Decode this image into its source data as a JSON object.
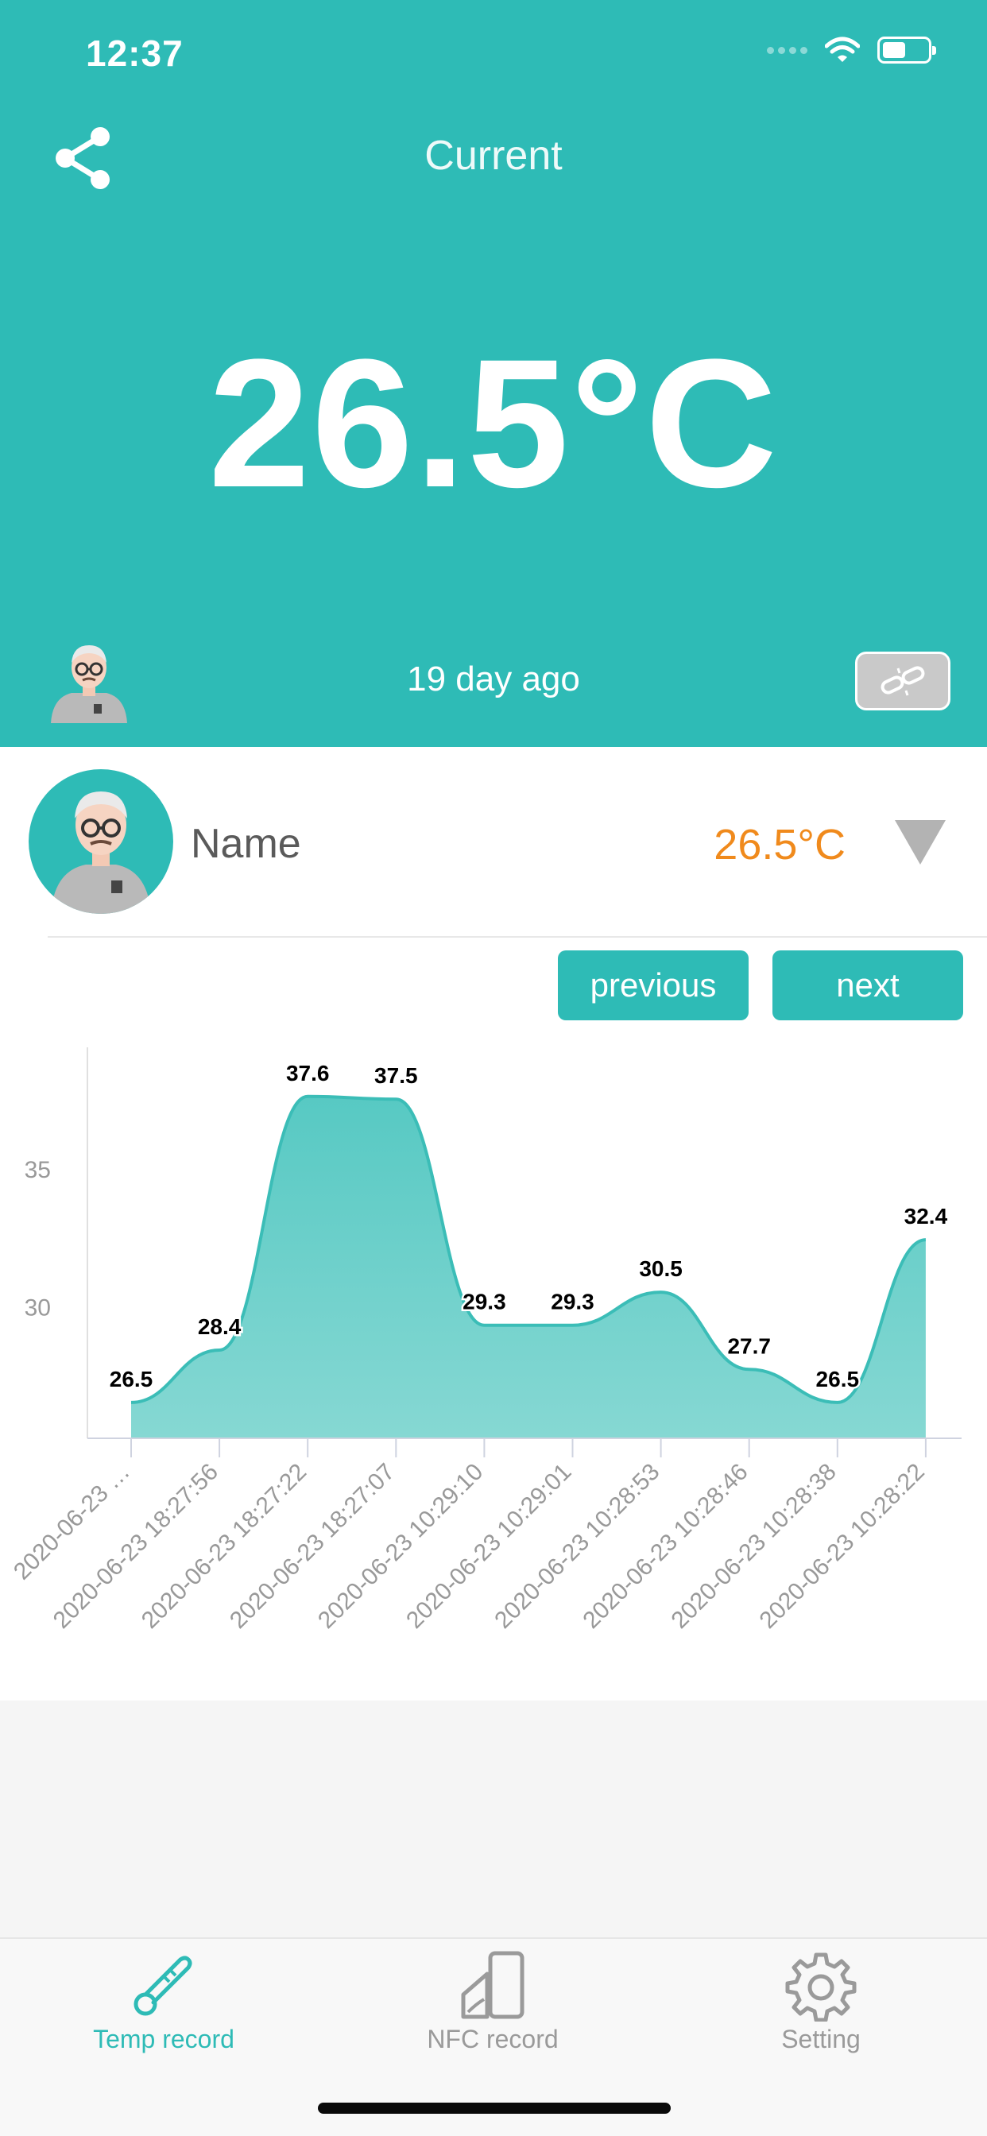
{
  "status_bar": {
    "time": "12:37",
    "icons": [
      "signal-dots-icon",
      "wifi-icon",
      "battery-icon"
    ]
  },
  "header": {
    "title": "Current",
    "temperature": "26.5°C",
    "last_update": "19 day ago",
    "share_icon": "share-icon",
    "unlink_icon": "unlink-icon",
    "background": "#2ebbb6"
  },
  "profile": {
    "name": "Name",
    "temperature": "26.5°C",
    "temp_color": "#f08a1c"
  },
  "nav_buttons": {
    "previous": "previous",
    "next": "next"
  },
  "chart_data": {
    "type": "area",
    "x": [
      "2020-06-23 …",
      "2020-06-23 18:27:56",
      "2020-06-23 18:27:22",
      "2020-06-23 18:27:07",
      "2020-06-23 10:29:10",
      "2020-06-23 10:29:01",
      "2020-06-23 10:28:53",
      "2020-06-23 10:28:46",
      "2020-06-23 10:28:38",
      "2020-06-23 10:28:22"
    ],
    "values": [
      26.5,
      28.4,
      37.6,
      37.5,
      29.3,
      29.3,
      30.5,
      27.7,
      26.5,
      32.4
    ],
    "yticks": [
      "35",
      "30"
    ],
    "ylim": [
      25.2,
      38.4
    ],
    "color": "#4ecbc4"
  },
  "tabbar": {
    "items": [
      {
        "label": "Temp record",
        "icon": "thermometer-icon",
        "active": true
      },
      {
        "label": "NFC record",
        "icon": "nfc-card-icon",
        "active": false
      },
      {
        "label": "Setting",
        "icon": "gear-icon",
        "active": false
      }
    ],
    "active_color": "#2ebbb6",
    "inactive_color": "#9a9a9a"
  }
}
